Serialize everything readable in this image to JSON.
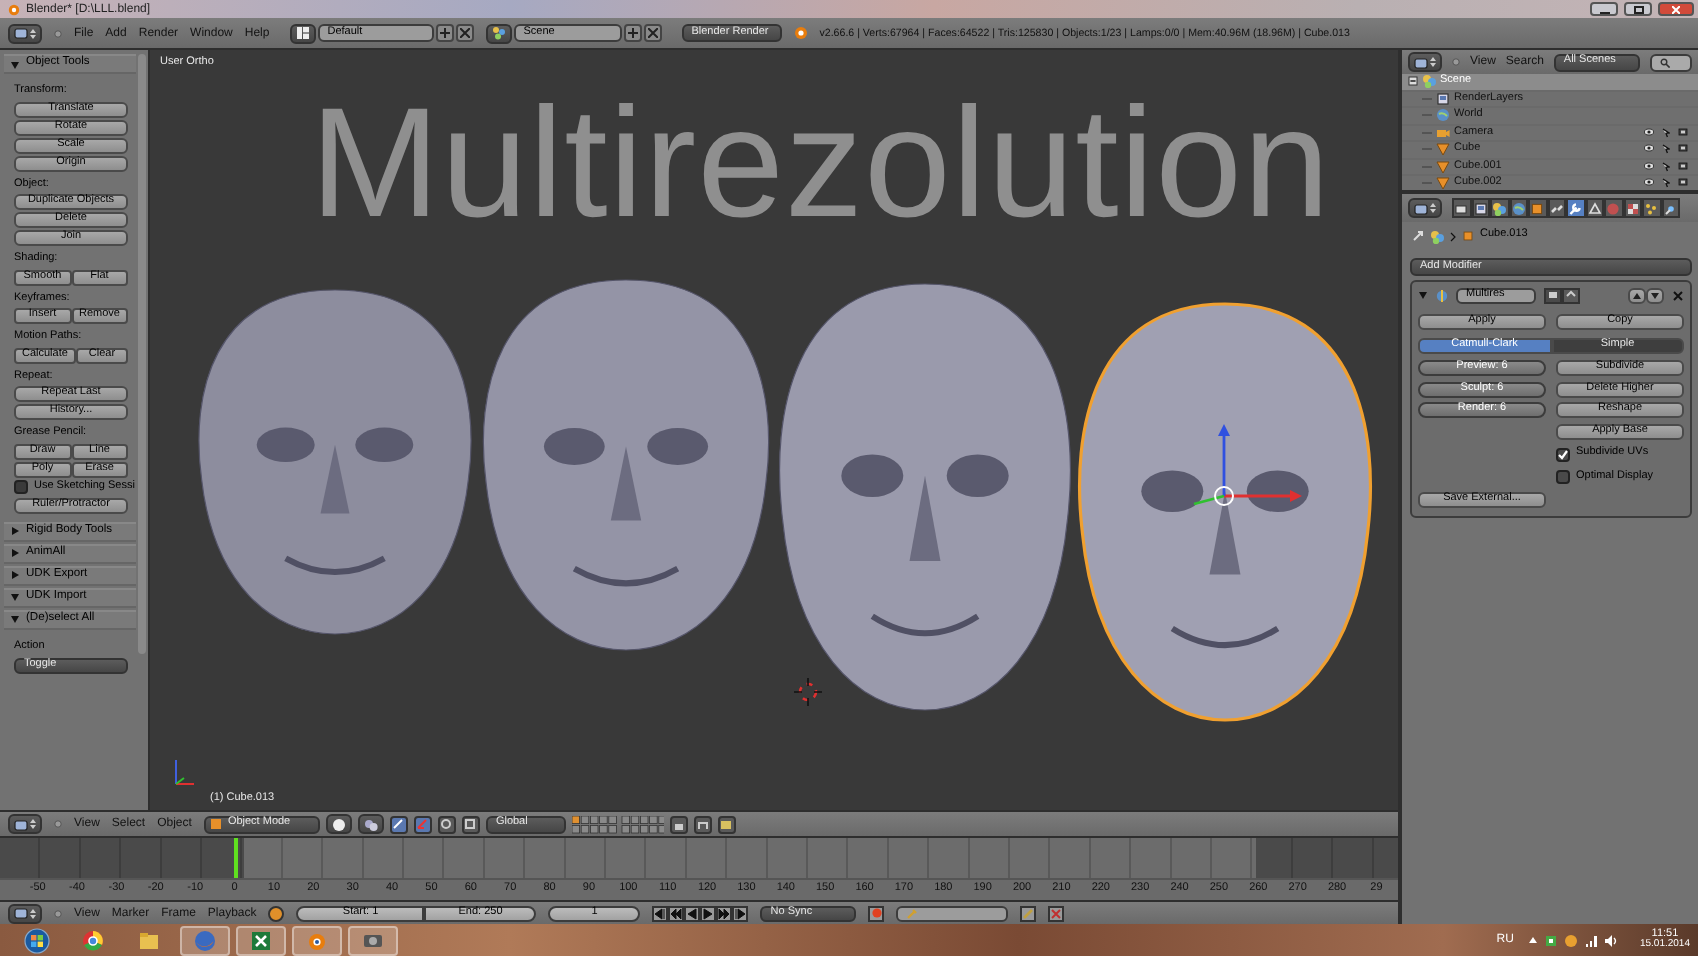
{
  "window": {
    "title": "Blender* [D:\\LLL.blend]"
  },
  "info_header": {
    "menus": [
      "File",
      "Add",
      "Render",
      "Window",
      "Help"
    ],
    "screen_layout": "Default",
    "scene": "Scene",
    "render_engine": "Blender Render",
    "stats": "v2.66.6 | Verts:67964 | Faces:64522 | Tris:125830 | Objects:1/23 | Lamps:0/0 | Mem:40.96M (18.96M) | Cube.013"
  },
  "tool_shelf": {
    "panels": [
      {
        "title": "Object Tools",
        "expanded": true,
        "items": [
          {
            "kind": "label",
            "text": "Transform:"
          },
          {
            "kind": "buttons",
            "labels": [
              "Translate"
            ]
          },
          {
            "kind": "buttons",
            "labels": [
              "Rotate"
            ]
          },
          {
            "kind": "buttons",
            "labels": [
              "Scale"
            ]
          },
          {
            "kind": "buttons",
            "labels": [
              "Origin"
            ]
          },
          {
            "kind": "label",
            "text": "Object:"
          },
          {
            "kind": "buttons",
            "labels": [
              "Duplicate Objects"
            ]
          },
          {
            "kind": "buttons",
            "labels": [
              "Delete"
            ]
          },
          {
            "kind": "buttons",
            "labels": [
              "Join"
            ]
          },
          {
            "kind": "label",
            "text": "Shading:"
          },
          {
            "kind": "buttons",
            "labels": [
              "Smooth",
              "Flat"
            ]
          },
          {
            "kind": "label",
            "text": "Keyframes:"
          },
          {
            "kind": "buttons",
            "labels": [
              "Insert",
              "Remove"
            ]
          },
          {
            "kind": "label",
            "text": "Motion Paths:"
          },
          {
            "kind": "buttons",
            "labels": [
              "Calculate",
              "Clear"
            ]
          },
          {
            "kind": "label",
            "text": "Repeat:"
          },
          {
            "kind": "buttons",
            "labels": [
              "Repeat Last"
            ]
          },
          {
            "kind": "buttons",
            "labels": [
              "History..."
            ]
          },
          {
            "kind": "label",
            "text": "Grease Pencil:"
          },
          {
            "kind": "buttons",
            "labels": [
              "Draw",
              "Line"
            ]
          },
          {
            "kind": "buttons",
            "labels": [
              "Poly",
              "Erase"
            ]
          },
          {
            "kind": "checkbox",
            "text": "Use Sketching Sessi",
            "checked": false
          },
          {
            "kind": "buttons",
            "labels": [
              "Ruler/Protractor"
            ]
          }
        ]
      },
      {
        "title": "Rigid Body Tools",
        "expanded": false
      },
      {
        "title": "AnimAll",
        "expanded": false
      },
      {
        "title": "UDK Export",
        "expanded": false
      },
      {
        "title": "UDK Import",
        "expanded": true
      },
      {
        "title": "(De)select All",
        "expanded": true,
        "items": [
          {
            "kind": "label",
            "text": "Action"
          },
          {
            "kind": "dropdown",
            "value": "Toggle"
          }
        ]
      }
    ]
  },
  "viewport": {
    "view_label": "User Ortho",
    "title_text": "Multirezolution",
    "object_label": "(1) Cube.013"
  },
  "viewport_header": {
    "menus": [
      "View",
      "Select",
      "Object"
    ],
    "mode": "Object Mode",
    "orientation": "Global"
  },
  "timeline": {
    "frame_ticks": [
      "-50",
      "-40",
      "-30",
      "-20",
      "-10",
      "0",
      "10",
      "20",
      "30",
      "40",
      "50",
      "60",
      "70",
      "80",
      "90",
      "100",
      "110",
      "120",
      "130",
      "140",
      "150",
      "160",
      "170",
      "180",
      "190",
      "200",
      "210",
      "220",
      "230",
      "240",
      "250",
      "260",
      "270",
      "280",
      "29"
    ]
  },
  "timeline_header": {
    "menus": [
      "View",
      "Marker",
      "Frame",
      "Playback"
    ],
    "start": "Start: 1",
    "end": "End: 250",
    "current_frame": "1",
    "sync": "No Sync"
  },
  "outliner": {
    "menus": [
      "View",
      "Search"
    ],
    "scope": "All Scenes",
    "tree": [
      {
        "label": "Scene",
        "kind": "scene",
        "selected": true,
        "children": [
          {
            "label": "RenderLayers",
            "kind": "layers",
            "selected": false
          },
          {
            "label": "World",
            "kind": "world",
            "selected": false
          },
          {
            "label": "Camera",
            "kind": "camera",
            "selected": false
          },
          {
            "label": "Cube",
            "kind": "mesh",
            "selected": false
          },
          {
            "label": "Cube.001",
            "kind": "mesh",
            "selected": false
          },
          {
            "label": "Cube.002",
            "kind": "mesh",
            "selected": false
          }
        ]
      }
    ]
  },
  "properties": {
    "tabs": [
      {
        "kind": "render",
        "selected": false
      },
      {
        "kind": "layers",
        "selected": false
      },
      {
        "kind": "scene",
        "selected": false
      },
      {
        "kind": "world",
        "selected": false
      },
      {
        "kind": "object",
        "selected": false
      },
      {
        "kind": "constraints",
        "selected": false
      },
      {
        "kind": "modifiers",
        "selected": true
      },
      {
        "kind": "data",
        "selected": false
      },
      {
        "kind": "material",
        "selected": false
      },
      {
        "kind": "texture",
        "selected": false
      },
      {
        "kind": "particles",
        "selected": false
      },
      {
        "kind": "physics",
        "selected": false
      }
    ],
    "object": "Cube.013",
    "add_modifier": "Add Modifier",
    "modifier": {
      "name": "Multires",
      "apply": "Apply",
      "copy": "Copy",
      "subdivision_types": [
        {
          "label": "Catmull-Clark",
          "selected": true
        },
        {
          "label": "Simple",
          "selected": false
        }
      ],
      "levels": [
        "Preview: 6",
        "Sculpt: 6",
        "Render: 6"
      ],
      "actions": [
        "Subdivide",
        "Delete Higher",
        "Reshape",
        "Apply Base"
      ],
      "options": [
        {
          "label": "Subdivide UVs",
          "checked": true
        },
        {
          "label": "Optimal Display",
          "checked": false
        }
      ],
      "save_external": "Save External..."
    }
  },
  "taskbar": {
    "language": "RU",
    "time": "11:51",
    "date": "15.01.2014"
  }
}
